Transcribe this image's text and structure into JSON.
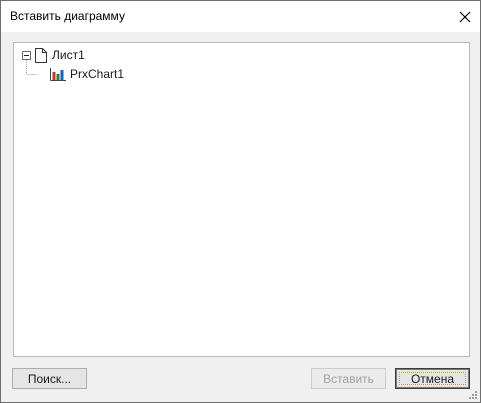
{
  "dialog": {
    "title": "Вставить диаграмму"
  },
  "tree": {
    "root": {
      "label": "Лист1",
      "icon": "document-icon",
      "expanded": true
    },
    "children": [
      {
        "label": "PrxChart1",
        "icon": "bar-chart-icon"
      }
    ]
  },
  "buttons": {
    "search_label": "Поиск...",
    "insert_label": "Вставить",
    "cancel_label": "Отмена"
  },
  "colors": {
    "chart_icon_colors": [
      "#c0392b",
      "#2e7d32",
      "#1565c0"
    ],
    "focus_rect": "#c0a060"
  }
}
